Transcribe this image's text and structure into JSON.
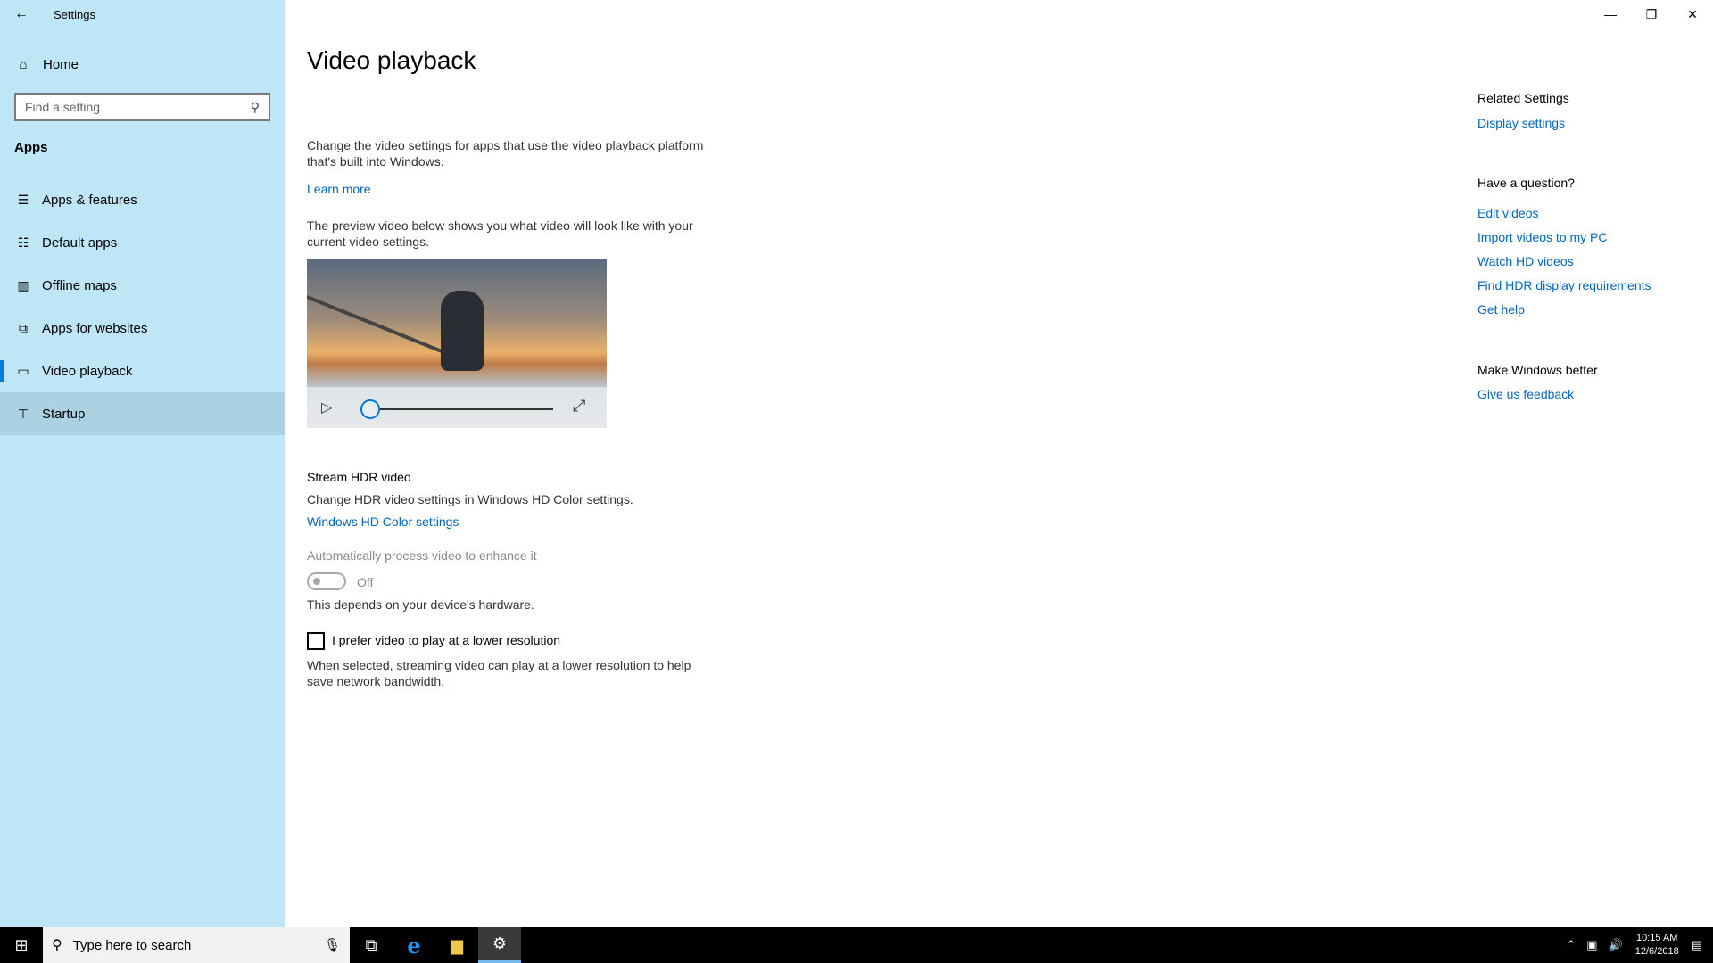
{
  "window": {
    "title": "Settings",
    "controls": {
      "minimize": "—",
      "restore": "❐",
      "close": "✕"
    }
  },
  "sidebar": {
    "home_label": "Home",
    "search_placeholder": "Find a setting",
    "section": "Apps",
    "items": [
      {
        "label": "Apps & features",
        "icon": "list-icon"
      },
      {
        "label": "Default apps",
        "icon": "default-apps-icon"
      },
      {
        "label": "Offline maps",
        "icon": "map-icon"
      },
      {
        "label": "Apps for websites",
        "icon": "websites-icon"
      },
      {
        "label": "Video playback",
        "icon": "video-icon",
        "selected": true
      },
      {
        "label": "Startup",
        "icon": "startup-icon",
        "hovered": true
      }
    ]
  },
  "main": {
    "title": "Video playback",
    "intro": "Change the video settings for apps that use the video playback platform that's built into Windows.",
    "learn_more": "Learn more",
    "preview_desc": "The preview video below shows you what video will look like with your current video settings.",
    "video": {
      "progress": 0.0
    },
    "hdr": {
      "heading": "Stream HDR video",
      "desc": "Change HDR video settings in Windows HD Color settings.",
      "link": "Windows HD Color settings"
    },
    "auto_process": {
      "label": "Automatically process video to enhance it",
      "state": "Off",
      "note": "This depends on your device's hardware."
    },
    "lower_res": {
      "label": "I prefer video to play at a lower resolution",
      "checked": false,
      "desc": "When selected, streaming video can play at a lower resolution to help save network bandwidth."
    }
  },
  "related": {
    "related_heading": "Related Settings",
    "display_settings": "Display settings",
    "question_heading": "Have a question?",
    "help_links": [
      "Edit videos",
      "Import videos to my PC",
      "Watch HD videos",
      "Find HDR display requirements",
      "Get help"
    ],
    "better_heading": "Make Windows better",
    "feedback": "Give us feedback"
  },
  "taskbar": {
    "search_placeholder": "Type here to search",
    "time": "10:15 AM",
    "date": "12/6/2018",
    "accent": "#76b9ed"
  }
}
